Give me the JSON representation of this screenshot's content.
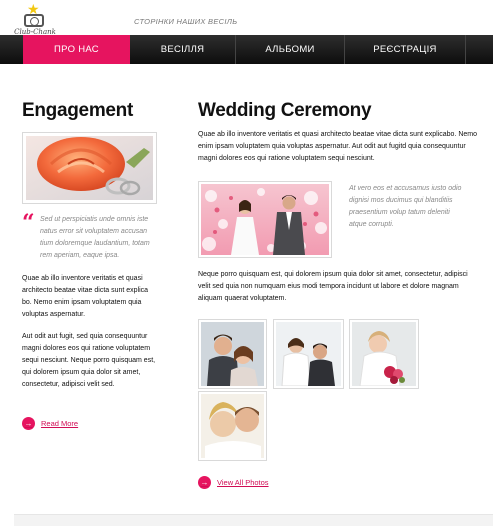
{
  "brand": {
    "logo_text": "Club-Chank",
    "tagline": "СТОРІНКИ НАШИХ ВЕСІЛЬ"
  },
  "nav": {
    "items": [
      {
        "label": "ПРО НАС",
        "active": true
      },
      {
        "label": "ВЕСІЛЛЯ",
        "active": false
      },
      {
        "label": "АЛЬБОМИ",
        "active": false
      },
      {
        "label": "РЕЄСТРАЦІЯ",
        "active": false
      }
    ]
  },
  "engagement": {
    "title": "Engagement",
    "quote": "Sed ut perspiciatis unde omnis iste natus error sit voluptatem accusan tium doloremque laudantium, totam rem aperiam, eaque ipsa.",
    "paragraph1": "Quae ab illo inventore veritatis et quasi architecto beatae vitae dicta sunt explica bo. Nemo enim ipsam voluptatem quia voluptas aspernatur.",
    "paragraph2": "Aut odit aut fugit, sed quia consequuntur magni dolores eos qui ratione voluptatem sequi nesciunt. Neque porro quisquam est, qui dolorem ipsum quia dolor sit amet, consectetur, adipisci velit sed.",
    "read_more": "Read More"
  },
  "ceremony": {
    "title": "Wedding Ceremony",
    "paragraph1": "Quae ab illo inventore veritatis et quasi architecto beatae vitae dicta sunt explicabo. Nemo enim ipsam voluptatem quia voluptas aspernatur. Aut odit aut fugitd quia consequuntur magni dolores eos qui ratione voluptatem sequi nesciunt.",
    "side_quote": "At vero eos et accusamus iusto odio dignisi mos ducimus qui blanditiis praesentium volup tatum deleniti atque corrupti.",
    "paragraph2": "Neque porro quisquam est, qui dolorem ipsum quia dolor sit amet, consectetur, adipisci velit sed quia non numquam eius modi tempora incidunt ut labore et dolore magnam aliquam quaerat voluptatem.",
    "view_all": "View All Photos"
  },
  "icons": {
    "arrow": "→",
    "quote": "“"
  },
  "colors": {
    "accent": "#e6145f",
    "nav_bg": "#111111"
  }
}
